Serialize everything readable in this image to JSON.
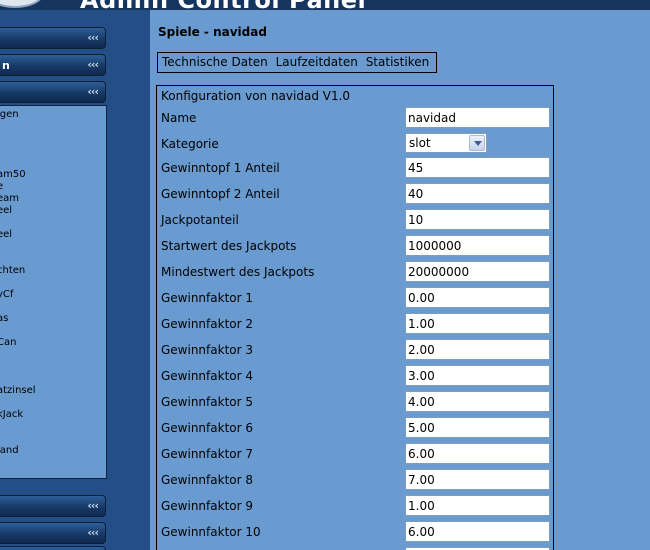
{
  "header": {
    "title": "Admin Control Panel"
  },
  "sidebar": {
    "chevron": "‹‹‹",
    "top_buttons": [
      {
        "label": ""
      },
      {
        "label": "n"
      },
      {
        "label": ""
      }
    ],
    "panel_items": [
      "igen",
      "am50",
      "e",
      "eam",
      "eel",
      "eel",
      "chten",
      "yCf",
      "as",
      "Can",
      "atzinsel",
      "kJack",
      "land"
    ],
    "bottom_buttons": [
      {
        "label": ""
      },
      {
        "label": ""
      },
      {
        "label": ""
      }
    ]
  },
  "main": {
    "title": "Spiele - navidad",
    "tabs": [
      "Technische Daten",
      "Laufzeitdaten",
      "Statistiken"
    ],
    "config": {
      "title": "Konfiguration von navidad V1.0",
      "name_label": "Name",
      "name_value": "navidad",
      "category_label": "Kategorie",
      "category_value": "slot",
      "fields": [
        {
          "label": "Gewinntopf 1 Anteil",
          "value": "45"
        },
        {
          "label": "Gewinntopf 2 Anteil",
          "value": "40"
        },
        {
          "label": "Jackpotanteil",
          "value": "10"
        },
        {
          "label": "Startwert des Jackpots",
          "value": "1000000"
        },
        {
          "label": "Mindestwert des Jackpots",
          "value": "20000000"
        },
        {
          "label": "Gewinnfaktor 1",
          "value": "0.00"
        },
        {
          "label": "Gewinnfaktor 2",
          "value": "1.00"
        },
        {
          "label": "Gewinnfaktor 3",
          "value": "2.00"
        },
        {
          "label": "Gewinnfaktor 4",
          "value": "3.00"
        },
        {
          "label": "Gewinnfaktor 5",
          "value": "4.00"
        },
        {
          "label": "Gewinnfaktor 6",
          "value": "5.00"
        },
        {
          "label": "Gewinnfaktor 7",
          "value": "6.00"
        },
        {
          "label": "Gewinnfaktor 8",
          "value": "7.00"
        },
        {
          "label": "Gewinnfaktor 9",
          "value": "1.00"
        },
        {
          "label": "Gewinnfaktor 10",
          "value": "6.00"
        },
        {
          "label": "",
          "value": ""
        }
      ]
    }
  }
}
